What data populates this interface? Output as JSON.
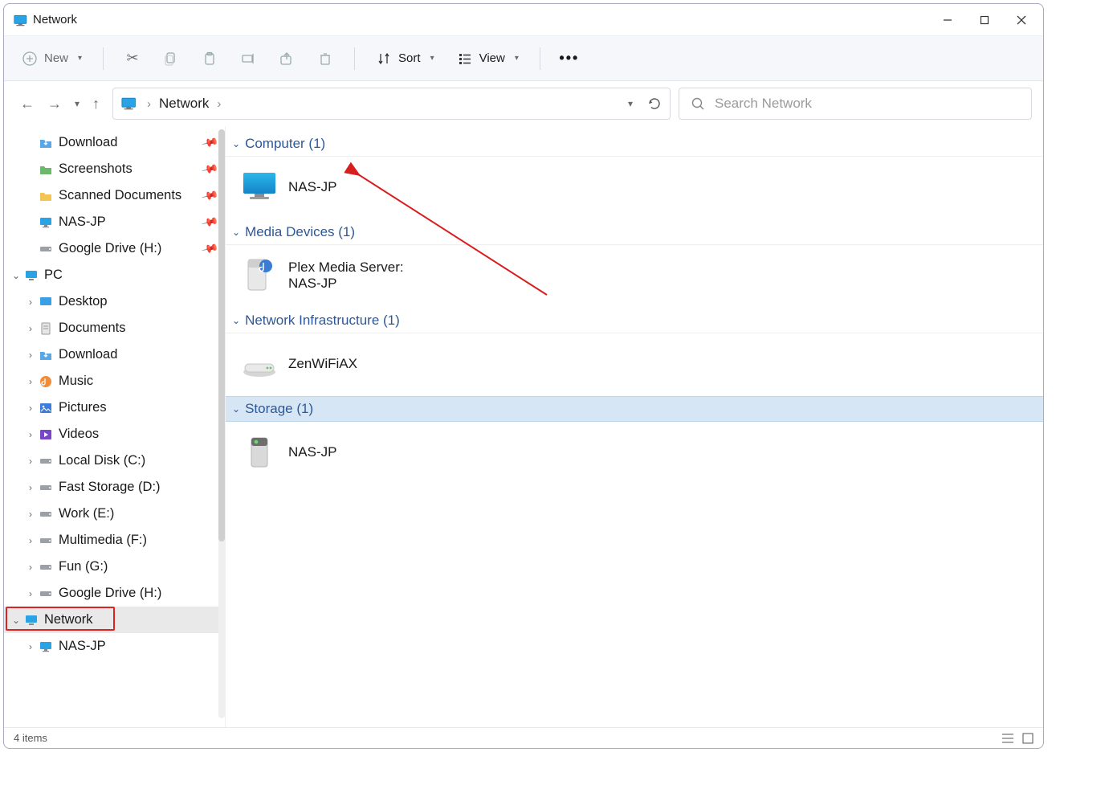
{
  "window": {
    "title": "Network"
  },
  "toolbar": {
    "new_label": "New",
    "sort_label": "Sort",
    "view_label": "View"
  },
  "address": {
    "crumb1": "Network",
    "search_placeholder": "Search Network"
  },
  "sidebar": {
    "pinned": [
      {
        "label": "Download",
        "icon": "download-folder"
      },
      {
        "label": "Screenshots",
        "icon": "folder-green"
      },
      {
        "label": "Scanned Documents",
        "icon": "folder"
      },
      {
        "label": "NAS-JP",
        "icon": "monitor"
      },
      {
        "label": "Google Drive (H:)",
        "icon": "drive"
      }
    ],
    "pc_label": "PC",
    "pc_children": [
      {
        "label": "Desktop",
        "icon": "desktop"
      },
      {
        "label": "Documents",
        "icon": "documents"
      },
      {
        "label": "Download",
        "icon": "download-folder"
      },
      {
        "label": "Music",
        "icon": "music"
      },
      {
        "label": "Pictures",
        "icon": "pictures"
      },
      {
        "label": "Videos",
        "icon": "videos"
      },
      {
        "label": "Local Disk (C:)",
        "icon": "drive"
      },
      {
        "label": "Fast Storage (D:)",
        "icon": "drive"
      },
      {
        "label": "Work (E:)",
        "icon": "drive"
      },
      {
        "label": "Multimedia (F:)",
        "icon": "drive"
      },
      {
        "label": "Fun (G:)",
        "icon": "drive"
      },
      {
        "label": "Google Drive (H:)",
        "icon": "drive"
      }
    ],
    "network_label": "Network",
    "network_children": [
      {
        "label": "NAS-JP",
        "icon": "monitor"
      }
    ]
  },
  "content": {
    "groups": [
      {
        "title": "Computer (1)",
        "items": [
          {
            "label": "NAS-JP",
            "icon": "pc-large"
          }
        ]
      },
      {
        "title": "Media Devices (1)",
        "items": [
          {
            "label": "Plex Media Server:",
            "label2": "NAS-JP",
            "icon": "media-device"
          }
        ]
      },
      {
        "title": "Network Infrastructure (1)",
        "items": [
          {
            "label": "ZenWiFiAX",
            "icon": "router"
          }
        ]
      },
      {
        "title": "Storage (1)",
        "selected": true,
        "items": [
          {
            "label": "NAS-JP",
            "icon": "storage"
          }
        ]
      }
    ]
  },
  "status": {
    "text": "4 items"
  },
  "icons": {
    "download-folder": "⬇",
    "folder-green": "📁",
    "folder": "📁",
    "monitor": "🖥",
    "drive": "▭",
    "desktop": "🖥",
    "documents": "📄",
    "music": "🎵",
    "pictures": "🖼",
    "videos": "🎬"
  }
}
